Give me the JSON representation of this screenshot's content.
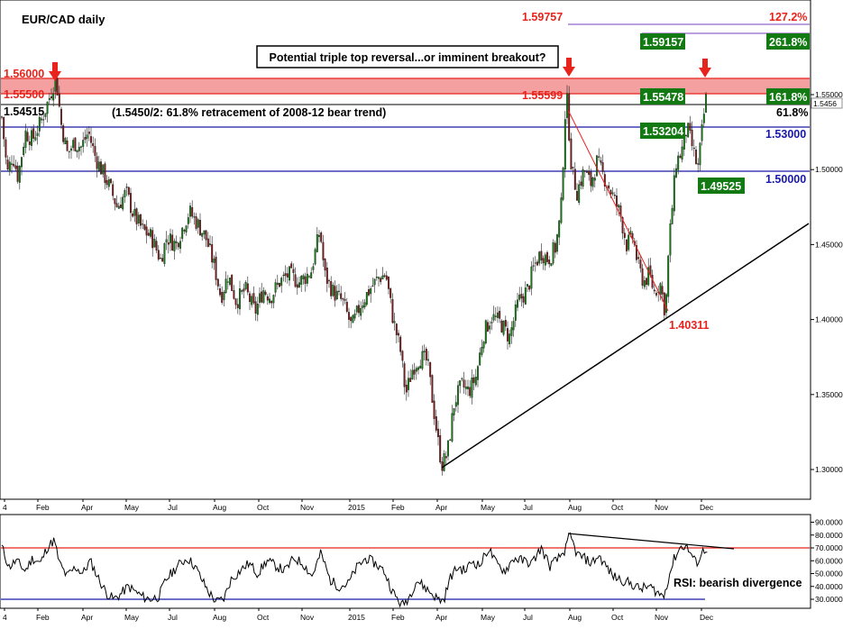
{
  "chart_data": {
    "type": "candlestick",
    "title": "EUR/CAD daily",
    "callout": "Potential triple top reversal...or imminent breakout?",
    "retracement_note": "(1.5450/2: 61.8% retracement of 2008-12 bear trend)",
    "rsi_note": "RSI: bearish divergence",
    "x_tick_labels": [
      {
        "label": "4",
        "x": 5
      },
      {
        "label": "Feb",
        "x": 42
      },
      {
        "label": "Apr",
        "x": 92
      },
      {
        "label": "May",
        "x": 140
      },
      {
        "label": "Jul",
        "x": 188
      },
      {
        "label": "Aug",
        "x": 238
      },
      {
        "label": "Oct",
        "x": 287
      },
      {
        "label": "Nov",
        "x": 335
      },
      {
        "label": "2015",
        "x": 388
      },
      {
        "label": "Feb",
        "x": 436
      },
      {
        "label": "Apr",
        "x": 485
      },
      {
        "label": "May",
        "x": 535
      },
      {
        "label": "Jul",
        "x": 582
      },
      {
        "label": "Aug",
        "x": 632
      },
      {
        "label": "Oct",
        "x": 680
      },
      {
        "label": "Nov",
        "x": 728
      },
      {
        "label": "Dec",
        "x": 778
      }
    ],
    "price_axis": {
      "range": [
        1.2945,
        1.5545
      ],
      "ticks": [
        "1.30000",
        "1.35000",
        "1.40000",
        "1.45000",
        "1.50000",
        "1.55000"
      ],
      "current_price": "1.5456"
    },
    "rsi_axis": {
      "range": [
        20,
        95
      ],
      "ticks": [
        "30.0000",
        "40.0000",
        "50.0000",
        "60.0000",
        "70.0000",
        "80.0000",
        "90.0000"
      ]
    },
    "series": [
      {
        "name": "EUR/CAD",
        "anchors": [
          [
            2,
            1.535
          ],
          [
            8,
            1.497
          ],
          [
            14,
            1.51
          ],
          [
            20,
            1.495
          ],
          [
            28,
            1.525
          ],
          [
            36,
            1.52
          ],
          [
            44,
            1.53
          ],
          [
            52,
            1.543
          ],
          [
            58,
            1.554
          ],
          [
            62,
            1.562
          ],
          [
            68,
            1.53
          ],
          [
            75,
            1.51
          ],
          [
            82,
            1.518
          ],
          [
            90,
            1.515
          ],
          [
            98,
            1.525
          ],
          [
            106,
            1.508
          ],
          [
            114,
            1.498
          ],
          [
            122,
            1.488
          ],
          [
            130,
            1.475
          ],
          [
            140,
            1.485
          ],
          [
            148,
            1.47
          ],
          [
            158,
            1.46
          ],
          [
            168,
            1.455
          ],
          [
            178,
            1.44
          ],
          [
            185,
            1.455
          ],
          [
            195,
            1.45
          ],
          [
            203,
            1.462
          ],
          [
            210,
            1.472
          ],
          [
            218,
            1.465
          ],
          [
            228,
            1.455
          ],
          [
            238,
            1.435
          ],
          [
            245,
            1.415
          ],
          [
            253,
            1.43
          ],
          [
            262,
            1.412
          ],
          [
            272,
            1.42
          ],
          [
            283,
            1.405
          ],
          [
            292,
            1.42
          ],
          [
            300,
            1.415
          ],
          [
            310,
            1.425
          ],
          [
            320,
            1.43
          ],
          [
            332,
            1.425
          ],
          [
            345,
            1.432
          ],
          [
            355,
            1.46
          ],
          [
            360,
            1.43
          ],
          [
            370,
            1.418
          ],
          [
            380,
            1.412
          ],
          [
            390,
            1.395
          ],
          [
            400,
            1.41
          ],
          [
            410,
            1.42
          ],
          [
            420,
            1.428
          ],
          [
            428,
            1.43
          ],
          [
            436,
            1.4
          ],
          [
            444,
            1.38
          ],
          [
            450,
            1.35
          ],
          [
            458,
            1.368
          ],
          [
            466,
            1.375
          ],
          [
            474,
            1.372
          ],
          [
            480,
            1.345
          ],
          [
            486,
            1.318
          ],
          [
            490,
            1.303
          ],
          [
            496,
            1.31
          ],
          [
            504,
            1.345
          ],
          [
            512,
            1.356
          ],
          [
            520,
            1.352
          ],
          [
            528,
            1.362
          ],
          [
            536,
            1.39
          ],
          [
            545,
            1.402
          ],
          [
            555,
            1.398
          ],
          [
            565,
            1.388
          ],
          [
            575,
            1.412
          ],
          [
            585,
            1.42
          ],
          [
            592,
            1.435
          ],
          [
            600,
            1.445
          ],
          [
            608,
            1.44
          ],
          [
            616,
            1.448
          ],
          [
            622,
            1.47
          ],
          [
            628,
            1.554
          ],
          [
            634,
            1.5
          ],
          [
            640,
            1.485
          ],
          [
            648,
            1.5
          ],
          [
            655,
            1.49
          ],
          [
            662,
            1.505
          ],
          [
            670,
            1.495
          ],
          [
            678,
            1.485
          ],
          [
            688,
            1.47
          ],
          [
            695,
            1.45
          ],
          [
            702,
            1.455
          ],
          [
            708,
            1.435
          ],
          [
            714,
            1.425
          ],
          [
            720,
            1.43
          ],
          [
            726,
            1.418
          ],
          [
            732,
            1.425
          ],
          [
            738,
            1.404
          ],
          [
            742,
            1.45
          ],
          [
            746,
            1.478
          ],
          [
            750,
            1.505
          ],
          [
            756,
            1.512
          ],
          [
            762,
            1.528
          ],
          [
            768,
            1.515
          ],
          [
            774,
            1.5
          ],
          [
            778,
            1.522
          ],
          [
            782,
            1.543
          ],
          [
            784,
            1.551
          ]
        ]
      },
      {
        "name": "RSI",
        "anchors": [
          [
            2,
            71
          ],
          [
            10,
            55
          ],
          [
            18,
            60
          ],
          [
            28,
            52
          ],
          [
            36,
            62
          ],
          [
            45,
            58
          ],
          [
            52,
            70
          ],
          [
            60,
            76
          ],
          [
            66,
            58
          ],
          [
            74,
            48
          ],
          [
            84,
            55
          ],
          [
            92,
            50
          ],
          [
            100,
            60
          ],
          [
            110,
            45
          ],
          [
            118,
            35
          ],
          [
            126,
            30
          ],
          [
            134,
            34
          ],
          [
            142,
            40
          ],
          [
            150,
            36
          ],
          [
            158,
            32
          ],
          [
            166,
            30
          ],
          [
            176,
            32
          ],
          [
            184,
            45
          ],
          [
            192,
            52
          ],
          [
            200,
            58
          ],
          [
            208,
            62
          ],
          [
            216,
            56
          ],
          [
            224,
            45
          ],
          [
            232,
            35
          ],
          [
            240,
            28
          ],
          [
            248,
            30
          ],
          [
            256,
            45
          ],
          [
            266,
            52
          ],
          [
            276,
            58
          ],
          [
            286,
            50
          ],
          [
            296,
            60
          ],
          [
            306,
            56
          ],
          [
            316,
            52
          ],
          [
            326,
            62
          ],
          [
            336,
            58
          ],
          [
            346,
            48
          ],
          [
            356,
            66
          ],
          [
            366,
            45
          ],
          [
            376,
            40
          ],
          [
            386,
            42
          ],
          [
            396,
            55
          ],
          [
            406,
            62
          ],
          [
            416,
            58
          ],
          [
            426,
            52
          ],
          [
            436,
            35
          ],
          [
            446,
            25
          ],
          [
            454,
            32
          ],
          [
            462,
            45
          ],
          [
            470,
            40
          ],
          [
            478,
            35
          ],
          [
            486,
            30
          ],
          [
            492,
            29
          ],
          [
            500,
            48
          ],
          [
            508,
            55
          ],
          [
            516,
            52
          ],
          [
            524,
            60
          ],
          [
            532,
            56
          ],
          [
            542,
            70
          ],
          [
            550,
            58
          ],
          [
            560,
            52
          ],
          [
            570,
            62
          ],
          [
            580,
            60
          ],
          [
            590,
            58
          ],
          [
            600,
            70
          ],
          [
            610,
            56
          ],
          [
            620,
            62
          ],
          [
            628,
            70
          ],
          [
            632,
            80
          ],
          [
            640,
            65
          ],
          [
            648,
            62
          ],
          [
            656,
            58
          ],
          [
            664,
            64
          ],
          [
            672,
            56
          ],
          [
            680,
            48
          ],
          [
            690,
            45
          ],
          [
            700,
            42
          ],
          [
            710,
            38
          ],
          [
            720,
            40
          ],
          [
            728,
            36
          ],
          [
            736,
            32
          ],
          [
            742,
            48
          ],
          [
            748,
            62
          ],
          [
            754,
            70
          ],
          [
            760,
            72
          ],
          [
            766,
            66
          ],
          [
            772,
            58
          ],
          [
            776,
            62
          ],
          [
            780,
            68
          ],
          [
            785,
            70
          ]
        ]
      }
    ],
    "horizontal_levels": [
      {
        "value": "1.56000",
        "color": "#e8231c"
      },
      {
        "value": "1.55500",
        "color": "#e8231c"
      },
      {
        "value": "1.54515",
        "color": "#000000"
      },
      {
        "value": "1.53000",
        "color": "#1919a8"
      },
      {
        "value": "1.50000",
        "color": "#1919a8"
      }
    ],
    "level_labels": {
      "r1_56000": "1.56000",
      "r1_55500": "1.55500",
      "r1_54515": "1.54515",
      "fib_61_8": "61.8%",
      "s1_53000": "1.53000",
      "s1_50000": "1.50000"
    },
    "extension_labels": {
      "e127_price": "1.59757",
      "e127_pct": "127.2%",
      "e261_price": "1.59157",
      "e261_pct": "261.8%",
      "e161_price": "1.55478",
      "e161_pct": "161.8%"
    },
    "swing_labels": {
      "aug_high": "1.55599",
      "nov_low": "1.40311",
      "nov_high": "1.53204",
      "dec_low": "1.49525"
    },
    "colors": {
      "resistance_band": "#f08080",
      "red": "#e8231c",
      "blue": "#1919a8",
      "green_box": "#137a13",
      "purple": "#7b3fbf",
      "candle_up": "#137a13",
      "candle_down": "#7a1a1a"
    }
  }
}
